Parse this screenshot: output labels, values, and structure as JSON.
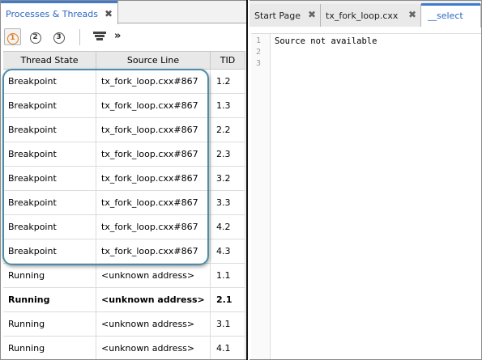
{
  "left_panel": {
    "tab_title": "Processes & Threads",
    "tab_close": "✖",
    "toolbar": {
      "btn1": "1",
      "btn2": "2",
      "btn3": "3",
      "more": "»"
    },
    "table": {
      "headers": [
        "Thread State",
        "Source Line",
        "TID"
      ],
      "rows": [
        {
          "state": "Breakpoint",
          "source": "tx_fork_loop.cxx#867",
          "tid": "1.2",
          "bold": false
        },
        {
          "state": "Breakpoint",
          "source": "tx_fork_loop.cxx#867",
          "tid": "1.3",
          "bold": false
        },
        {
          "state": "Breakpoint",
          "source": "tx_fork_loop.cxx#867",
          "tid": "2.2",
          "bold": false
        },
        {
          "state": "Breakpoint",
          "source": "tx_fork_loop.cxx#867",
          "tid": "2.3",
          "bold": false
        },
        {
          "state": "Breakpoint",
          "source": "tx_fork_loop.cxx#867",
          "tid": "3.2",
          "bold": false
        },
        {
          "state": "Breakpoint",
          "source": "tx_fork_loop.cxx#867",
          "tid": "3.3",
          "bold": false
        },
        {
          "state": "Breakpoint",
          "source": "tx_fork_loop.cxx#867",
          "tid": "4.2",
          "bold": false
        },
        {
          "state": "Breakpoint",
          "source": "tx_fork_loop.cxx#867",
          "tid": "4.3",
          "bold": false
        },
        {
          "state": "Running",
          "source": "<unknown address>",
          "tid": "1.1",
          "bold": false
        },
        {
          "state": "Running",
          "source": "<unknown address>",
          "tid": "2.1",
          "bold": true
        },
        {
          "state": "Running",
          "source": "<unknown address>",
          "tid": "3.1",
          "bold": false
        },
        {
          "state": "Running",
          "source": "<unknown address>",
          "tid": "4.1",
          "bold": false
        }
      ]
    }
  },
  "right_panel": {
    "tabs": [
      {
        "label": "Start Page",
        "close": "✖"
      },
      {
        "label": "tx_fork_loop.cxx",
        "close": "✖"
      },
      {
        "label": "__select"
      }
    ],
    "editor": {
      "line_numbers": [
        "1",
        "2",
        "3"
      ],
      "content": "Source not available"
    }
  },
  "colors": {
    "active_tab_accent": "#3d7bd1",
    "active_tab_text": "#2a66c4",
    "highlight_border": "#4a8ea8",
    "selected_button_icon": "#e07b1a"
  }
}
